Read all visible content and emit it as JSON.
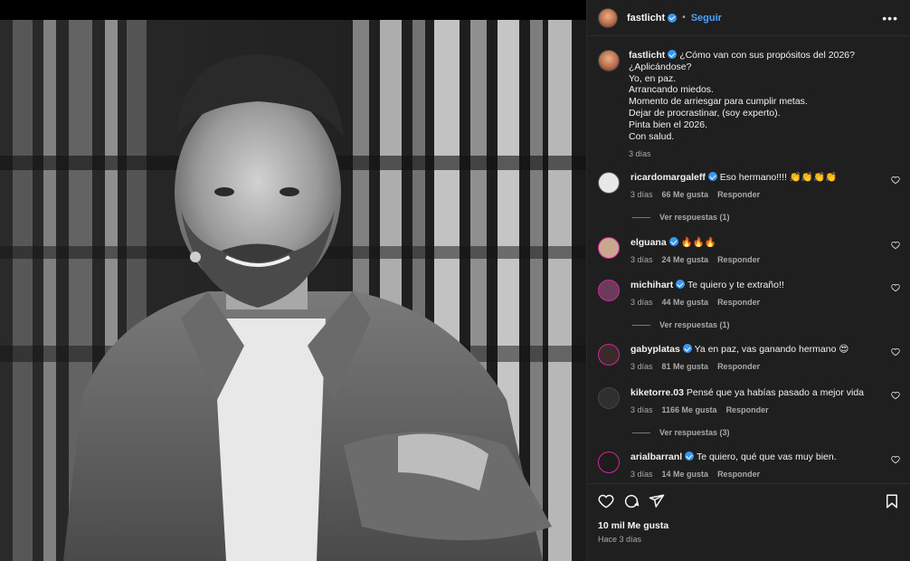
{
  "post": {
    "author": "fastlicht",
    "follow_label": "Seguir",
    "more_label": "•••",
    "caption_lines": [
      "¿Cómo van con sus propósitos del 2026?",
      "¿Aplicándose?",
      "Yo, en paz.",
      "Arrancando miedos.",
      "Momento de arriesgar para cumplir metas.",
      "Dejar de procrastinar, (soy experto).",
      "Pinta bien el 2026.",
      "Con salud."
    ],
    "caption_time": "3 días",
    "likes_label": "10 mil Me gusta",
    "posted_ago": "Hace 3 días"
  },
  "comments": [
    {
      "user": "ricardomargaleff",
      "text": "Eso hermano!!!! 👏👏👏👏",
      "time": "3 días",
      "likes": "66 Me gusta",
      "reply": "Responder",
      "replies": "Ver respuestas (1)",
      "avatar_color": "#e8e8e8"
    },
    {
      "user": "elguana",
      "text": "🔥🔥🔥",
      "time": "3 días",
      "likes": "24 Me gusta",
      "reply": "Responder",
      "replies": "",
      "avatar_color": "#c9a78e"
    },
    {
      "user": "michihart",
      "text": "Te quiero y te extraño!!",
      "time": "3 días",
      "likes": "44 Me gusta",
      "reply": "Responder",
      "replies": "Ver respuestas (1)",
      "avatar_color": "#6b3b5a"
    },
    {
      "user": "gabyplatas",
      "text": "Ya en paz, vas ganando hermano 😍",
      "time": "3 días",
      "likes": "81 Me gusta",
      "reply": "Responder",
      "replies": "",
      "avatar_color": "#3a2a2a"
    },
    {
      "user": "kiketorre.03",
      "text": "Pensé que ya habías pasado a mejor vida",
      "time": "3 días",
      "likes": "1166 Me gusta",
      "reply": "Responder",
      "replies": "Ver respuestas (3)",
      "avatar_color": "#2f2f2f"
    },
    {
      "user": "arialbarranl",
      "text": "Te quiero, qué que vas muy bien.",
      "time": "3 días",
      "likes": "14 Me gusta",
      "reply": "Responder",
      "replies": "",
      "avatar_color": "#1d1d1d"
    }
  ],
  "icons": {
    "like": "heart-icon",
    "comment": "comment-icon",
    "share": "share-icon",
    "save": "bookmark-icon"
  },
  "colors": {
    "accent": "#4aa4ff",
    "verified": "#3897f0",
    "panel_bg": "#1f1f1f"
  }
}
